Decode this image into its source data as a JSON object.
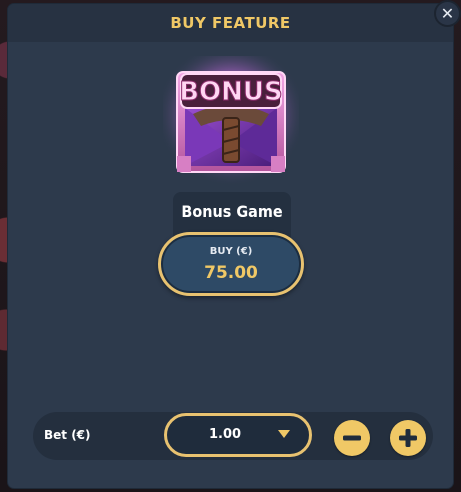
{
  "dialog": {
    "title": "BUY FEATURE",
    "close_icon": "close-icon"
  },
  "feature": {
    "art_text": "BONUS",
    "name": "Bonus Game",
    "buy_label": "BUY (€)",
    "price": "75.00"
  },
  "bet": {
    "label": "Bet (€)",
    "value": "1.00",
    "decrease_icon": "minus-icon",
    "increase_icon": "plus-icon"
  },
  "colors": {
    "accent": "#f0c866",
    "panel": "#2d3a4c",
    "button": "#2e4a66"
  }
}
